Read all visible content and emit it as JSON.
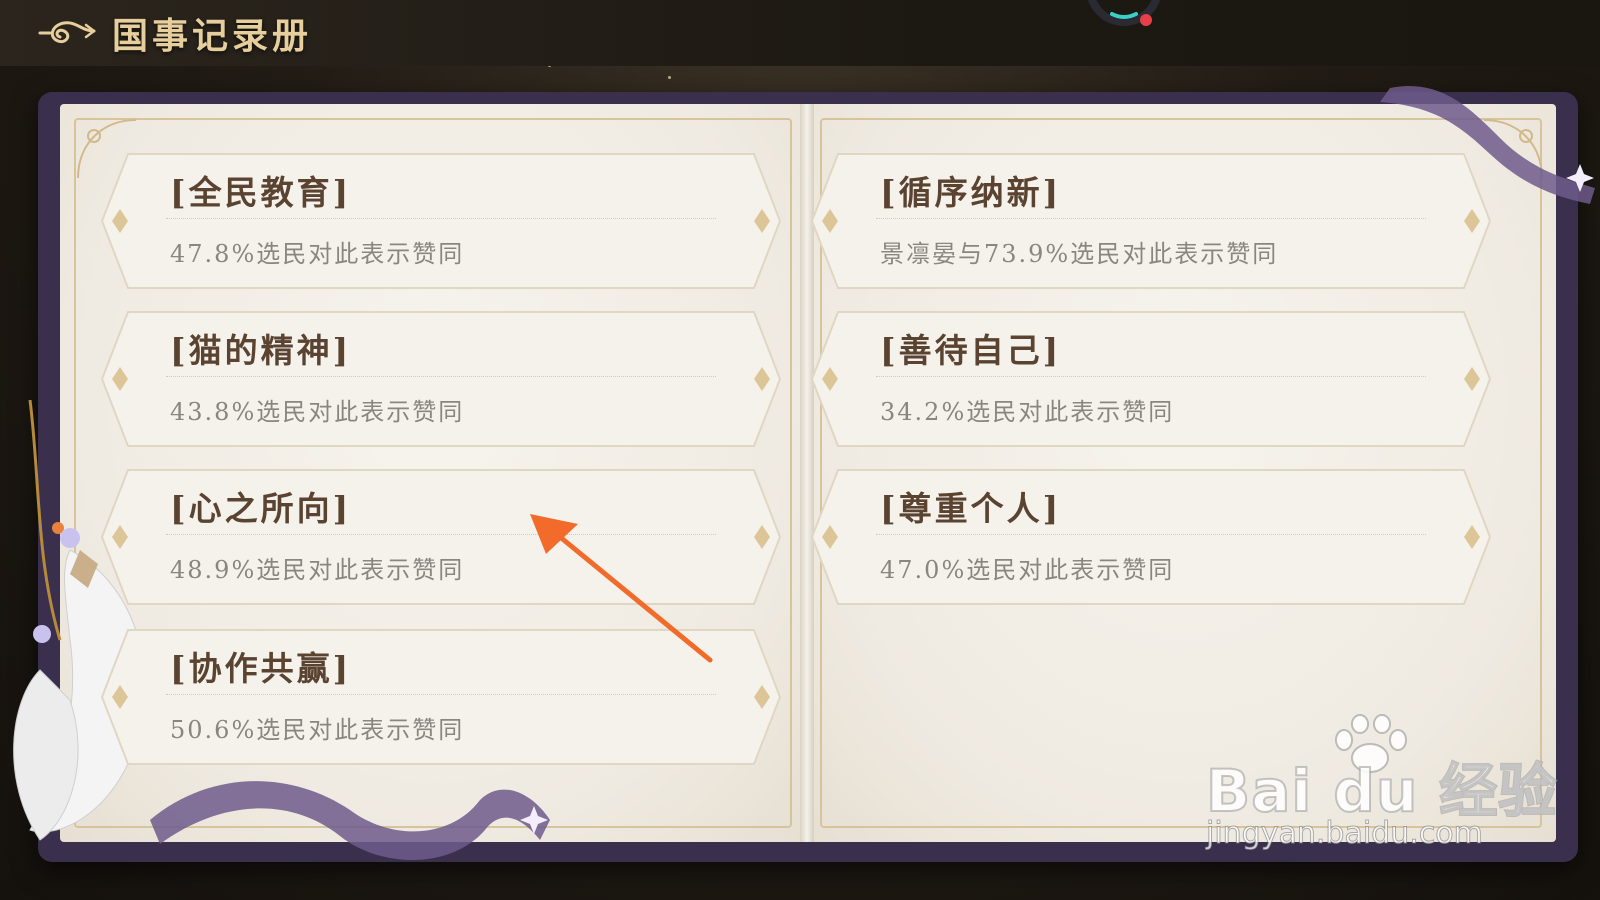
{
  "header": {
    "title": "国事记录册",
    "back_icon": "swirl-back-icon"
  },
  "left_page": {
    "cards": [
      {
        "title": "[全民教育]",
        "desc": "47.8%选民对此表示赞同"
      },
      {
        "title": "[猫的精神]",
        "desc": "43.8%选民对此表示赞同"
      },
      {
        "title": "[心之所向]",
        "desc": "48.9%选民对此表示赞同"
      },
      {
        "title": "[协作共赢]",
        "desc": "50.6%选民对此表示赞同"
      }
    ]
  },
  "right_page": {
    "cards": [
      {
        "title": "[循序纳新]",
        "desc": "景凛晏与73.9%选民对此表示赞同"
      },
      {
        "title": "[善待自己]",
        "desc": "34.2%选民对此表示赞同"
      },
      {
        "title": "[尊重个人]",
        "desc": "47.0%选民对此表示赞同"
      }
    ]
  },
  "watermark": {
    "logo": "Bai du 经验",
    "url": "jingyan.baidu.com"
  },
  "colors": {
    "title_gold": "#e6cf9d",
    "card_title": "#5a4330",
    "card_desc": "#8a8580",
    "book_cover": "#3b2f4e",
    "arrow": "#f26b2a"
  }
}
